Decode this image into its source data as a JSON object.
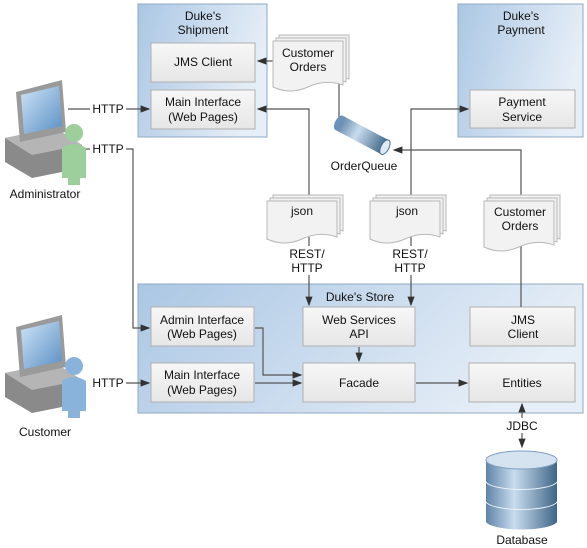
{
  "shipment": {
    "title_line1": "Duke's",
    "title_line2": "Shipment",
    "jms_client": "JMS Client",
    "main_interface_line1": "Main Interface",
    "main_interface_line2": "(Web Pages)"
  },
  "payment": {
    "title_line1": "Duke's",
    "title_line2": "Payment",
    "service_line1": "Payment",
    "service_line2": "Service"
  },
  "store": {
    "title": "Duke's Store",
    "admin_interface_line1": "Admin Interface",
    "admin_interface_line2": "(Web Pages)",
    "web_services_line1": "Web Services",
    "web_services_line2": "API",
    "jms_client_line1": "JMS",
    "jms_client_line2": "Client",
    "main_interface_line1": "Main Interface",
    "main_interface_line2": "(Web Pages)",
    "facade": "Facade",
    "entities": "Entities"
  },
  "documents": {
    "customer_orders_line1": "Customer",
    "customer_orders_line2": "Orders",
    "json": "json"
  },
  "queue": {
    "label": "OrderQueue"
  },
  "protocols": {
    "http": "HTTP",
    "rest_line1": "REST/",
    "rest_line2": "HTTP",
    "jdbc": "JDBC"
  },
  "actors": {
    "administrator": "Administrator",
    "customer": "Customer"
  },
  "database": {
    "label": "Database"
  },
  "colors": {
    "container": "#b5cde6",
    "admin_person": "#9ccf9c",
    "customer_person": "#8ab3dc"
  }
}
